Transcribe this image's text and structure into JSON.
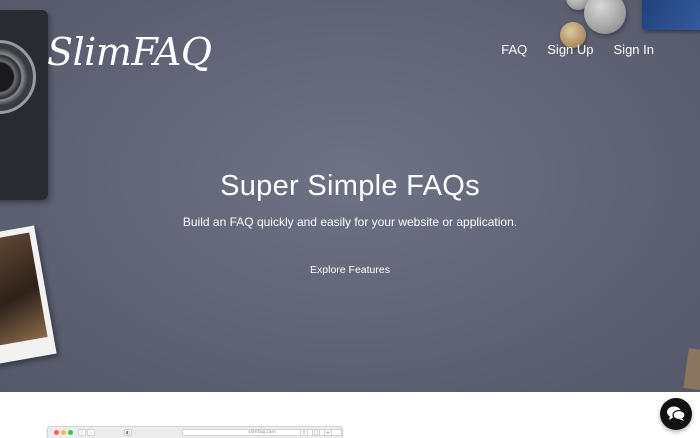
{
  "brand": {
    "logo_text": "SlimFAQ"
  },
  "nav": {
    "items": [
      {
        "label": "FAQ"
      },
      {
        "label": "Sign Up"
      },
      {
        "label": "Sign In"
      }
    ]
  },
  "hero": {
    "title": "Super Simple FAQs",
    "subtitle": "Build an FAQ quickly and easily for your website or application.",
    "cta_label": "Explore Features",
    "background_color": "#5f6375"
  },
  "browser_mockup": {
    "url": "slimfaq.com"
  },
  "chat_widget": {
    "icon": "chat-bubbles-icon",
    "color": "#111111"
  },
  "colors": {
    "hero_text": "#ffffff",
    "page_background": "#ffffff"
  }
}
